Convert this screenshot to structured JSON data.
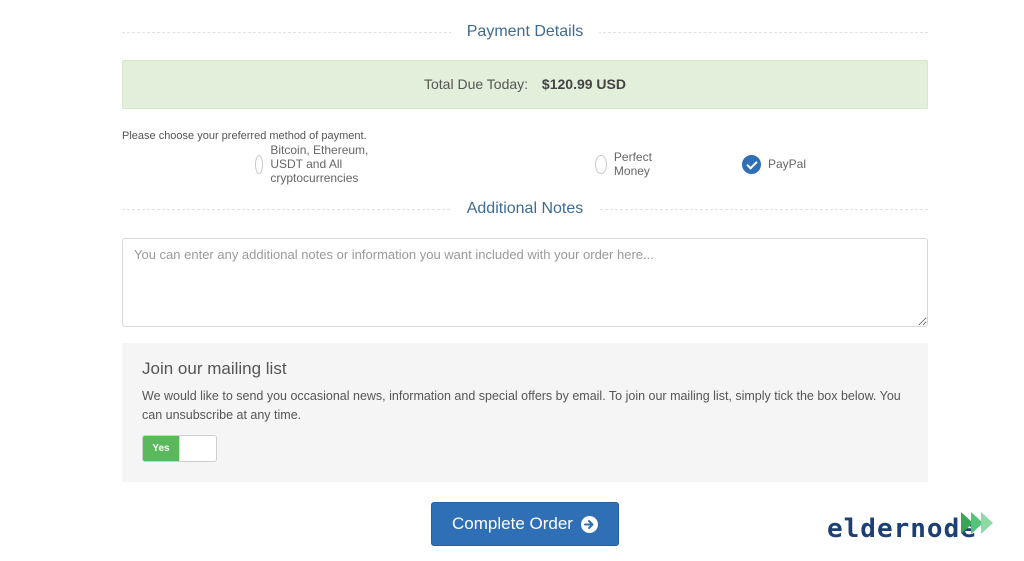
{
  "payment_section": {
    "title": "Payment Details"
  },
  "total": {
    "label": "Total Due Today:",
    "amount": "$120.99 USD"
  },
  "payment_prompt": "Please choose your preferred method of payment.",
  "payment_methods": [
    {
      "label": "Bitcoin, Ethereum, USDT and All cryptocurrencies",
      "selected": false
    },
    {
      "label": "Perfect Money",
      "selected": false
    },
    {
      "label": "PayPal",
      "selected": true
    }
  ],
  "notes_section": {
    "title": "Additional Notes",
    "placeholder": "You can enter any additional notes or information you want included with your order here..."
  },
  "mailing": {
    "title": "Join our mailing list",
    "text": "We would like to send you occasional news, information and special offers by email. To join our mailing list, simply tick the box below. You can unsubscribe at any time.",
    "toggle_label": "Yes"
  },
  "submit": {
    "label": "Complete Order",
    "icon": "arrow-circle-right-icon"
  },
  "brand": {
    "name": "eldernode",
    "color": "#1d3f73",
    "accent": "#3aa655"
  }
}
